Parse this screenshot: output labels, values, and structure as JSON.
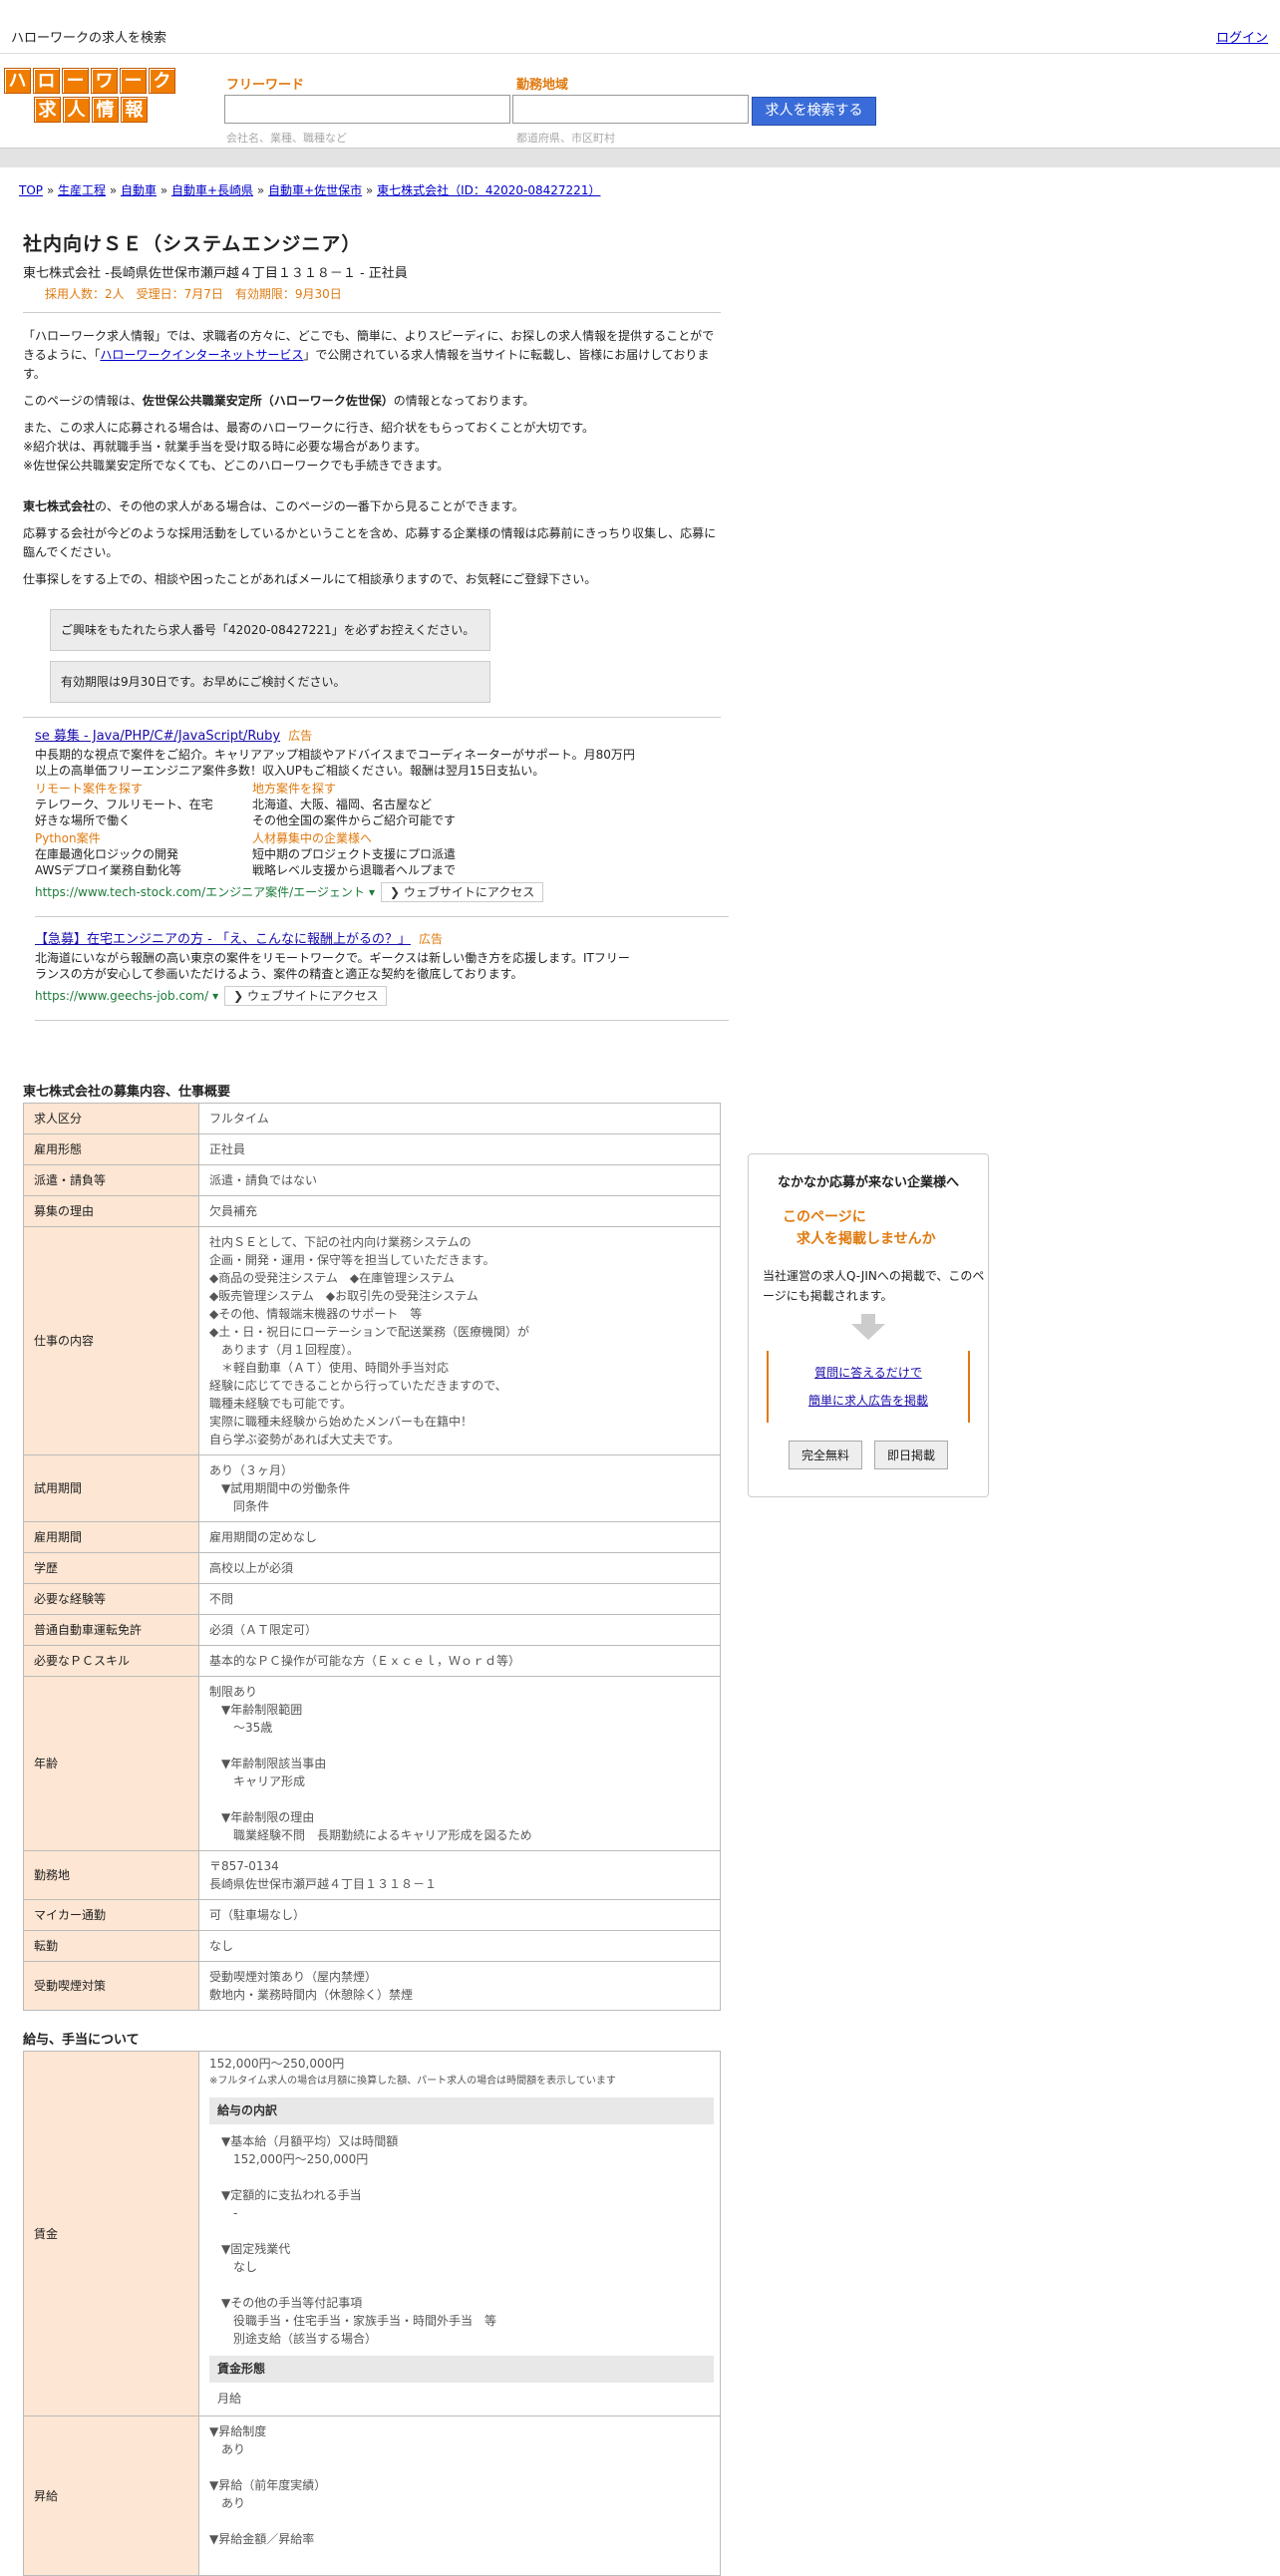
{
  "header": {
    "site_title": "ハローワークの求人を検索",
    "login": "ログイン",
    "logo_row1": [
      "ハ",
      "ロ",
      "ー",
      "ワ",
      "ー",
      "ク"
    ],
    "logo_row2": [
      "求",
      "人",
      "情",
      "報"
    ],
    "freeword_label": "フリーワード",
    "freeword_hint": "会社名、業種、職種など",
    "area_label": "勤務地域",
    "area_hint": "都道府県、市区町村",
    "search_button": "求人を検索する"
  },
  "breadcrumb": {
    "items": [
      "TOP",
      "生産工程",
      "自動車",
      "自動車+長崎県",
      "自動車+佐世保市",
      "東七株式会社（ID：42020-08427221）"
    ],
    "sep": " » "
  },
  "job": {
    "title": "社内向けＳＥ（システムエンジニア）",
    "company_line": "東七株式会社 -長崎県佐世保市瀬戸越４丁目１３１８－１ - 正社員",
    "meta_line": "採用人数：2人　受理日：7月7日　有効期限：9月30日"
  },
  "intro": {
    "p1a": "「ハローワーク求人情報」では、求職者の方々に、どこでも、簡単に、よりスピーディに、お探しの求人情報を提供することができるように、「",
    "p1link": "ハローワークインターネットサービス",
    "p1b": "」で公開されている求人情報を当サイトに転載し、皆様にお届けしております。",
    "p2a": "このページの情報は、",
    "p2bold": "佐世保公共職業安定所（ハローワーク佐世保）",
    "p2b": "の情報となっております。",
    "p3": "また、この求人に応募される場合は、最寄のハローワークに行き、紹介状をもらっておくことが大切です。",
    "p4": "※紹介状は、再就職手当・就業手当を受け取る時に必要な場合があります。",
    "p5": "※佐世保公共職業安定所でなくても、どこのハローワークでも手続きできます。",
    "p6bold": "東七株式会社",
    "p6": "の、その他の求人がある場合は、このページの一番下から見ることができます。",
    "p7": "応募する会社が今どのような採用活動をしているかということを含め、応募する企業様の情報は応募前にきっちり収集し、応募に臨んでください。",
    "p8": "仕事探しをする上での、相談や困ったことがあればメールにて相談承りますので、お気軽にご登録下さい。",
    "notice1": "ご興味をもたれたら求人番号「42020-08427221」を必ずお控えください。",
    "notice2": "有効期限は9月30日です。お早めにご検討ください。"
  },
  "ads": [
    {
      "title": "se 募集 - Java/PHP/C#/JavaScript/Ruby",
      "badge": "広告",
      "desc": "中長期的な視点で案件をご紹介。キャリアアップ相談やアドバイスまでコーディネーターがサポート。月80万円以上の高単価フリーエンジニア案件多数！収入UPもご相談ください。報酬は翌月15日支払い。",
      "sitelinks": [
        {
          "h": "リモート案件を探す",
          "l1": "テレワーク、フルリモート、在宅",
          "l2": "好きな場所で働く"
        },
        {
          "h": "地方案件を探す",
          "l1": "北海道、大阪、福岡、名古屋など",
          "l2": "その他全国の案件からご紹介可能です"
        },
        {
          "h": "Python案件",
          "l1": "在庫最適化ロジックの開発",
          "l2": "AWSデプロイ業務自動化等"
        },
        {
          "h": "人材募集中の企業様へ",
          "l1": "短中期のプロジェクト支援にプロ派遣",
          "l2": "戦略レベル支援から退職者ヘルプまで"
        }
      ],
      "url": "https://www.tech-stock.com/エンジニア案件/エージェント",
      "visit": "ウェブサイトにアクセス"
    },
    {
      "title": "【急募】在宅エンジニアの方 - 「え、こんなに報酬上がるの？」",
      "badge": "広告",
      "desc": "北海道にいながら報酬の高い東京の案件をリモートワークで。ギークスは新しい働き方を応援します。ITフリーランスの方が安心して参画いただけるよう、案件の精査と適正な契約を徹底しております。",
      "url": "https://www.geechs-job.com/",
      "visit": "ウェブサイトにアクセス"
    }
  ],
  "spec_section": {
    "heading": "東七株式会社の募集内容、仕事概要",
    "rows": [
      {
        "k": "求人区分",
        "v": "フルタイム"
      },
      {
        "k": "雇用形態",
        "v": "正社員"
      },
      {
        "k": "派遣・請負等",
        "v": "派遣・請負ではない"
      },
      {
        "k": "募集の理由",
        "v": "欠員補充"
      },
      {
        "k": "仕事の内容",
        "v": "社内ＳＥとして、下記の社内向け業務システムの\n企画・開発・運用・保守等を担当していただきます。\n◆商品の受発注システム　◆在庫管理システム\n◆販売管理システム　◆お取引先の受発注システム\n◆その他、情報端末機器のサポート　等\n◆土・日・祝日にローテーションで配送業務（医療機関）が\n　あります（月１回程度）。\n　＊軽自動車（ＡＴ）使用、時間外手当対応\n経験に応じてできることから行っていただきますので、\n職種未経験でも可能です。\n実際に職種未経験から始めたメンバーも在籍中！\n自ら学ぶ姿勢があれば大丈夫です。"
      },
      {
        "k": "試用期間",
        "v": "あり（３ヶ月）\n　▼試用期間中の労働条件\n　　同条件"
      },
      {
        "k": "雇用期間",
        "v": "雇用期間の定めなし"
      },
      {
        "k": "学歴",
        "v": "高校以上が必須"
      },
      {
        "k": "必要な経験等",
        "v": "不問"
      },
      {
        "k": "普通自動車運転免許",
        "v": "必須（ＡＴ限定可）"
      },
      {
        "k": "必要なＰＣスキル",
        "v": "基本的なＰＣ操作が可能な方（Ｅｘｃｅｌ，Ｗｏｒｄ等）"
      },
      {
        "k": "年齢",
        "v": "制限あり\n　▼年齢制限範囲\n　　〜35歳\n\n　▼年齢制限該当事由\n　　キャリア形成\n\n　▼年齢制限の理由\n　　職業経験不問　長期勤続によるキャリア形成を図るため"
      },
      {
        "k": "勤務地",
        "v": "〒857-0134\n長崎県佐世保市瀬戸越４丁目１３１８－１"
      },
      {
        "k": "マイカー通勤",
        "v": "可（駐車場なし）"
      },
      {
        "k": "転勤",
        "v": "なし"
      },
      {
        "k": "受動喫煙対策",
        "v": "受動喫煙対策あり（屋内禁煙）\n敷地内・業務時間内（休憩除く）禁煙"
      }
    ]
  },
  "pay_section": {
    "heading": "給与、手当について",
    "wage_key": "賃金",
    "wage_range": "152,000円〜250,000円",
    "wage_note": "※フルタイム求人の場合は月額に換算した額、パート求人の場合は時間額を表示しています",
    "breakdown_head": "給与の内訳",
    "breakdown": "　▼基本給（月額平均）又は時間額\n　　152,000円〜250,000円\n\n　▼定額的に支払われる手当\n　　-\n\n　▼固定残業代\n　　なし\n\n　▼その他の手当等付記事項\n　　役職手当・住宅手当・家族手当・時間外手当　等\n　　別途支給（該当する場合）",
    "form_head": "賃金形態",
    "form_value": "月給",
    "raise_key": "昇給",
    "raise": "▼昇給制度\n　あり\n\n▼昇給（前年度実績）\n　あり\n\n▼昇給金額／昇給率"
  },
  "sidebox": {
    "t1": "なかなか応募が来ない企業様へ",
    "t2a": "このページに",
    "t2b": "求人を掲載しませんか",
    "t3": "当社運営の求人Q-JINへの掲載で、このページにも掲載されます。",
    "link1": "質問に答えるだけで",
    "link2": "簡単に求人広告を掲載",
    "btn1": "完全無料",
    "btn2": "即日掲載"
  }
}
